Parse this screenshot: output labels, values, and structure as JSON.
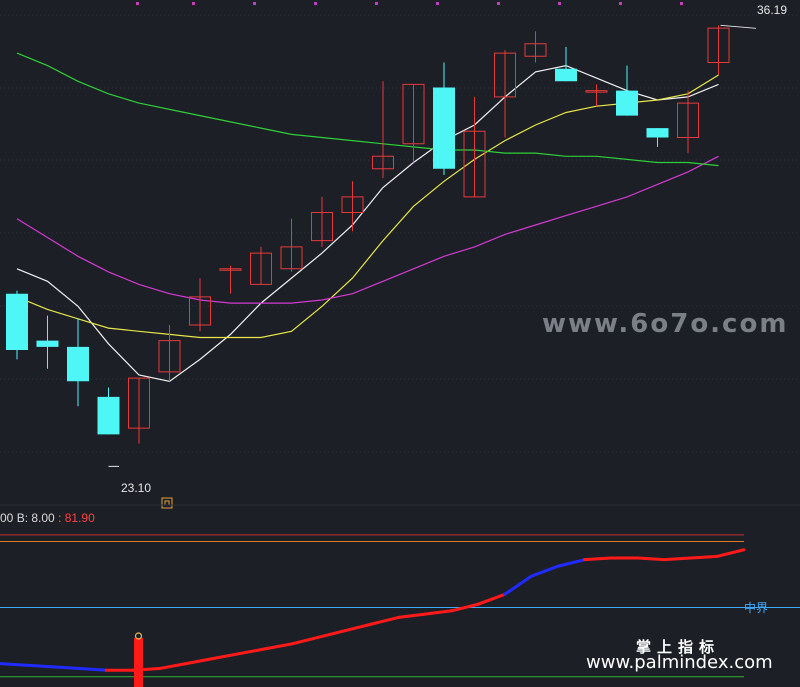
{
  "colors": {
    "background": "#1d1f26",
    "grid": "#2e3240",
    "up": "#e63a3a",
    "down": "#4ef6f6",
    "ma_white": "#f0f0f0",
    "ma_yellow": "#e6e64a",
    "ma_magenta": "#d23bd2",
    "ma_green": "#2fcf3a",
    "ind_red": "#ff1a1a",
    "ind_blue": "#1f2bff",
    "mid_line": "#3fa9ff",
    "ref_red": "#c33030",
    "ref_orange": "#e07a28",
    "ref_green": "#2fb02f"
  },
  "price_panel": {
    "high_label": "36.19",
    "low_label": "23.10",
    "watermark": "www.6o7o.com"
  },
  "indicator_panel": {
    "label_prefix": "00",
    "label_b": "B: 8.00",
    "label_sep": " : ",
    "label_value": "81.90",
    "mid_label": "中界"
  },
  "branding": {
    "name_cn": "掌上指标",
    "url": "www.palmindex.com"
  },
  "chart_data": {
    "type": "candlestick",
    "title": "",
    "y_range": [
      21.0,
      37.0
    ],
    "candles": [
      {
        "o": 27.6,
        "h": 27.7,
        "l": 25.5,
        "c": 25.8
      },
      {
        "o": 26.1,
        "h": 26.9,
        "l": 25.2,
        "c": 25.9
      },
      {
        "o": 25.9,
        "h": 26.8,
        "l": 24.0,
        "c": 24.8
      },
      {
        "o": 24.3,
        "h": 24.6,
        "l": 23.1,
        "c": 23.1
      },
      {
        "o": 23.3,
        "h": 24.9,
        "l": 22.8,
        "c": 24.9
      },
      {
        "o": 25.1,
        "h": 26.6,
        "l": 24.8,
        "c": 26.1
      },
      {
        "o": 26.6,
        "h": 28.1,
        "l": 26.4,
        "c": 27.5
      },
      {
        "o": 28.4,
        "h": 28.5,
        "l": 27.6,
        "c": 28.4
      },
      {
        "o": 27.9,
        "h": 29.1,
        "l": 27.9,
        "c": 28.9
      },
      {
        "o": 28.4,
        "h": 30.0,
        "l": 28.3,
        "c": 29.1
      },
      {
        "o": 29.3,
        "h": 30.7,
        "l": 29.1,
        "c": 30.2
      },
      {
        "o": 30.2,
        "h": 31.2,
        "l": 29.6,
        "c": 30.7
      },
      {
        "o": 31.6,
        "h": 34.4,
        "l": 31.3,
        "c": 32.0
      },
      {
        "o": 32.4,
        "h": 34.3,
        "l": 31.8,
        "c": 34.3
      },
      {
        "o": 34.2,
        "h": 35.0,
        "l": 31.4,
        "c": 31.6
      },
      {
        "o": 30.7,
        "h": 33.9,
        "l": 30.7,
        "c": 32.8
      },
      {
        "o": 33.9,
        "h": 35.4,
        "l": 32.6,
        "c": 35.3
      },
      {
        "o": 35.2,
        "h": 36.0,
        "l": 35.0,
        "c": 35.6
      },
      {
        "o": 34.8,
        "h": 35.5,
        "l": 34.4,
        "c": 34.4
      },
      {
        "o": 34.1,
        "h": 34.3,
        "l": 33.6,
        "c": 34.1
      },
      {
        "o": 34.1,
        "h": 34.9,
        "l": 33.3,
        "c": 33.3
      },
      {
        "o": 32.9,
        "h": 32.9,
        "l": 32.3,
        "c": 32.6
      },
      {
        "o": 32.6,
        "h": 34.1,
        "l": 32.1,
        "c": 33.7
      },
      {
        "o": 35.0,
        "h": 36.19,
        "l": 34.6,
        "c": 36.1
      }
    ],
    "ma_series": [
      {
        "color_key": "ma_white",
        "values": [
          28.4,
          28.0,
          27.2,
          26.0,
          25.0,
          24.8,
          25.5,
          26.3,
          27.3,
          28.1,
          28.9,
          29.8,
          31.0,
          31.8,
          32.5,
          33.0,
          33.9,
          34.7,
          34.9,
          34.5,
          34.1,
          33.8,
          33.9,
          34.3
        ]
      },
      {
        "color_key": "ma_yellow",
        "values": [
          27.5,
          27.1,
          26.8,
          26.5,
          26.4,
          26.3,
          26.2,
          26.2,
          26.2,
          26.4,
          27.2,
          28.1,
          29.3,
          30.4,
          31.2,
          31.9,
          32.5,
          33.0,
          33.4,
          33.6,
          33.7,
          33.8,
          34.0,
          34.6
        ]
      },
      {
        "color_key": "ma_magenta",
        "values": [
          30.0,
          29.4,
          28.8,
          28.3,
          27.9,
          27.6,
          27.4,
          27.3,
          27.3,
          27.3,
          27.4,
          27.6,
          28.0,
          28.4,
          28.8,
          29.1,
          29.5,
          29.8,
          30.1,
          30.4,
          30.7,
          31.1,
          31.5,
          32.0
        ]
      },
      {
        "color_key": "ma_green",
        "values": [
          35.3,
          34.9,
          34.4,
          34.0,
          33.7,
          33.5,
          33.3,
          33.1,
          32.9,
          32.7,
          32.6,
          32.5,
          32.4,
          32.3,
          32.2,
          32.2,
          32.1,
          32.1,
          32.0,
          32.0,
          31.9,
          31.8,
          31.8,
          31.7
        ]
      }
    ],
    "indicator": {
      "y_range": [
        0,
        100
      ],
      "mid": 50,
      "refs": [
        {
          "value": 94,
          "color_key": "ref_red"
        },
        {
          "value": 90,
          "color_key": "ref_orange"
        },
        {
          "value": 8,
          "color_key": "ref_green"
        }
      ],
      "values": [
        16,
        15,
        14,
        13,
        12,
        12,
        13,
        16,
        19,
        22,
        25,
        28,
        32,
        36,
        40,
        44,
        46,
        48,
        52,
        58,
        69,
        75,
        79,
        80,
        80,
        79,
        80,
        81,
        85
      ],
      "blue_segments": [
        [
          0,
          4
        ],
        [
          19,
          22
        ]
      ]
    }
  }
}
